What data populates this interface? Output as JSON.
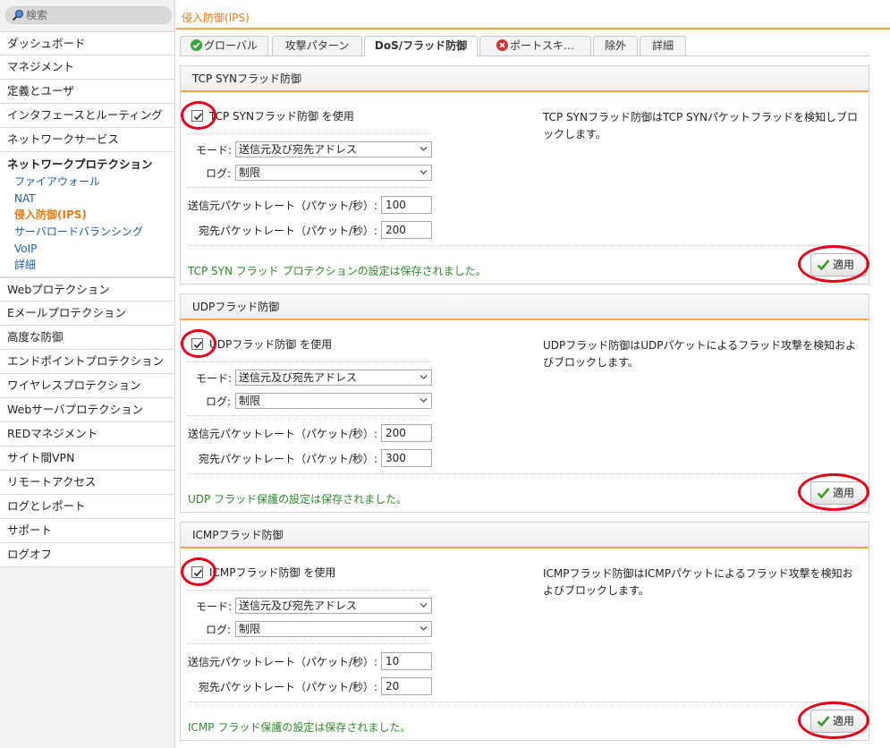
{
  "search": {
    "placeholder": "検索"
  },
  "page": {
    "title": "侵入防御(IPS)"
  },
  "sidebar": {
    "items_before": [
      "ダッシュボード",
      "マネジメント",
      "定義とユーザ",
      "インタフェースとルーティング",
      "ネットワークサービス"
    ],
    "group": {
      "title": "ネットワークプロテクション",
      "subitems": [
        "ファイアウォール",
        "NAT",
        "侵入防御(IPS)",
        "サーバロードバランシング",
        "VoIP",
        "詳細"
      ],
      "active_index": 2
    },
    "items_after": [
      "Webプロテクション",
      "Eメールプロテクション",
      "高度な防御",
      "エンドポイントプロテクション",
      "ワイヤレスプロテクション",
      "Webサーバプロテクション",
      "REDマネジメント",
      "サイト間VPN",
      "リモートアクセス",
      "ログとレポート",
      "サポート",
      "ログオフ"
    ]
  },
  "tabs": [
    {
      "label": "グローバル",
      "icon": "check-circle-icon"
    },
    {
      "label": "攻撃パターン"
    },
    {
      "label": "DoS/フラッド防御",
      "active": true
    },
    {
      "label": "ポートスキ…",
      "icon": "error-circle-icon"
    },
    {
      "label": "除外"
    },
    {
      "label": "詳細"
    }
  ],
  "form": {
    "mode_label": "モード:",
    "log_label": "ログ:",
    "src_rate_label": "送信元パケットレート（パケット/秒）:",
    "dst_rate_label": "宛先パケットレート（パケット/秒）:",
    "apply_label": "適用"
  },
  "panels": [
    {
      "title": "TCP SYNフラッド防御",
      "enable_label": "TCP SYNフラッド防御 を使用",
      "enabled": true,
      "mode": "送信元及び宛先アドレス",
      "log": "制限",
      "src_rate": "100",
      "dst_rate": "200",
      "description": "TCP SYNフラッド防御はTCP SYNパケットフラッドを検知しブロックします。",
      "saved_message": "TCP SYN フラッド プロテクションの設定は保存されました。"
    },
    {
      "title": "UDPフラッド防御",
      "enable_label": "UDPフラッド防御 を使用",
      "enabled": true,
      "mode": "送信元及び宛先アドレス",
      "log": "制限",
      "src_rate": "200",
      "dst_rate": "300",
      "description": "UDPフラッド防御はUDPパケットによるフラッド攻撃を検知およびブロックします。",
      "saved_message": "UDP フラッド保護の設定は保存されました。"
    },
    {
      "title": "ICMPフラッド防御",
      "enable_label": "ICMPフラッド防御 を使用",
      "enabled": true,
      "mode": "送信元及び宛先アドレス",
      "log": "制限",
      "src_rate": "10",
      "dst_rate": "20",
      "description": "ICMPフラッド防御はICMPパケットによるフラッド攻撃を検知およびブロックします。",
      "saved_message": "ICMP フラッド保護の設定は保存されました。"
    }
  ],
  "colors": {
    "accent": "#f0a64a",
    "active_text": "#e47b1a",
    "link": "#1f5fa0",
    "success": "#2f8a2f",
    "highlight_ring": "#e5001c"
  }
}
